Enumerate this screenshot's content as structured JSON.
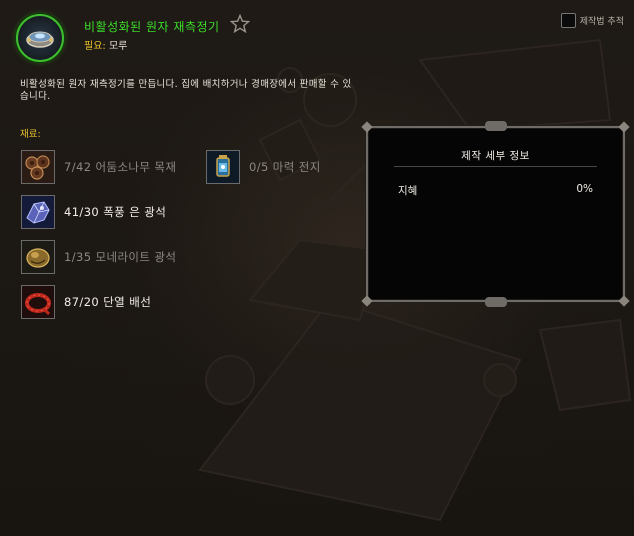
{
  "recipe": {
    "title": "비활성화된 원자 재측정기",
    "requires_label": "필요:",
    "requires_value": "모루",
    "favorite_icon": "star-outline-icon",
    "item_icon": "atomic-recalibrator-icon",
    "quality_color": "#3bde29"
  },
  "track_recipe_label": "제작법 추적",
  "description": "비활성화된 원자 재측정기를 만듭니다. 집에 배치하거나 경매장에서 판매할 수 있습니다.",
  "materials_label": "재료:",
  "reagents": [
    {
      "text": "7/42 어둠소나무 목재",
      "icon": "shadowpine-lumber-icon",
      "state": "insufficient"
    },
    {
      "text": "41/30 폭풍 은 광석",
      "icon": "storm-silver-ore-icon",
      "state": "sufficient"
    },
    {
      "text": "1/35 모네라이트 광석",
      "icon": "monerite-ore-icon",
      "state": "insufficient"
    },
    {
      "text": "87/20 단열 배선",
      "icon": "insulated-wiring-icon",
      "state": "sufficient"
    },
    {
      "text": "0/5 마력 전지",
      "icon": "mana-battery-icon",
      "state": "insufficient"
    }
  ],
  "crafting_details": {
    "title": "제작 세부 정보",
    "stat_name": "지혜",
    "stat_value": "0%"
  },
  "colors": {
    "materials_label": "#e8c22b",
    "insufficient_text": "#8c8782",
    "sufficient_text": "#f2ede6"
  }
}
